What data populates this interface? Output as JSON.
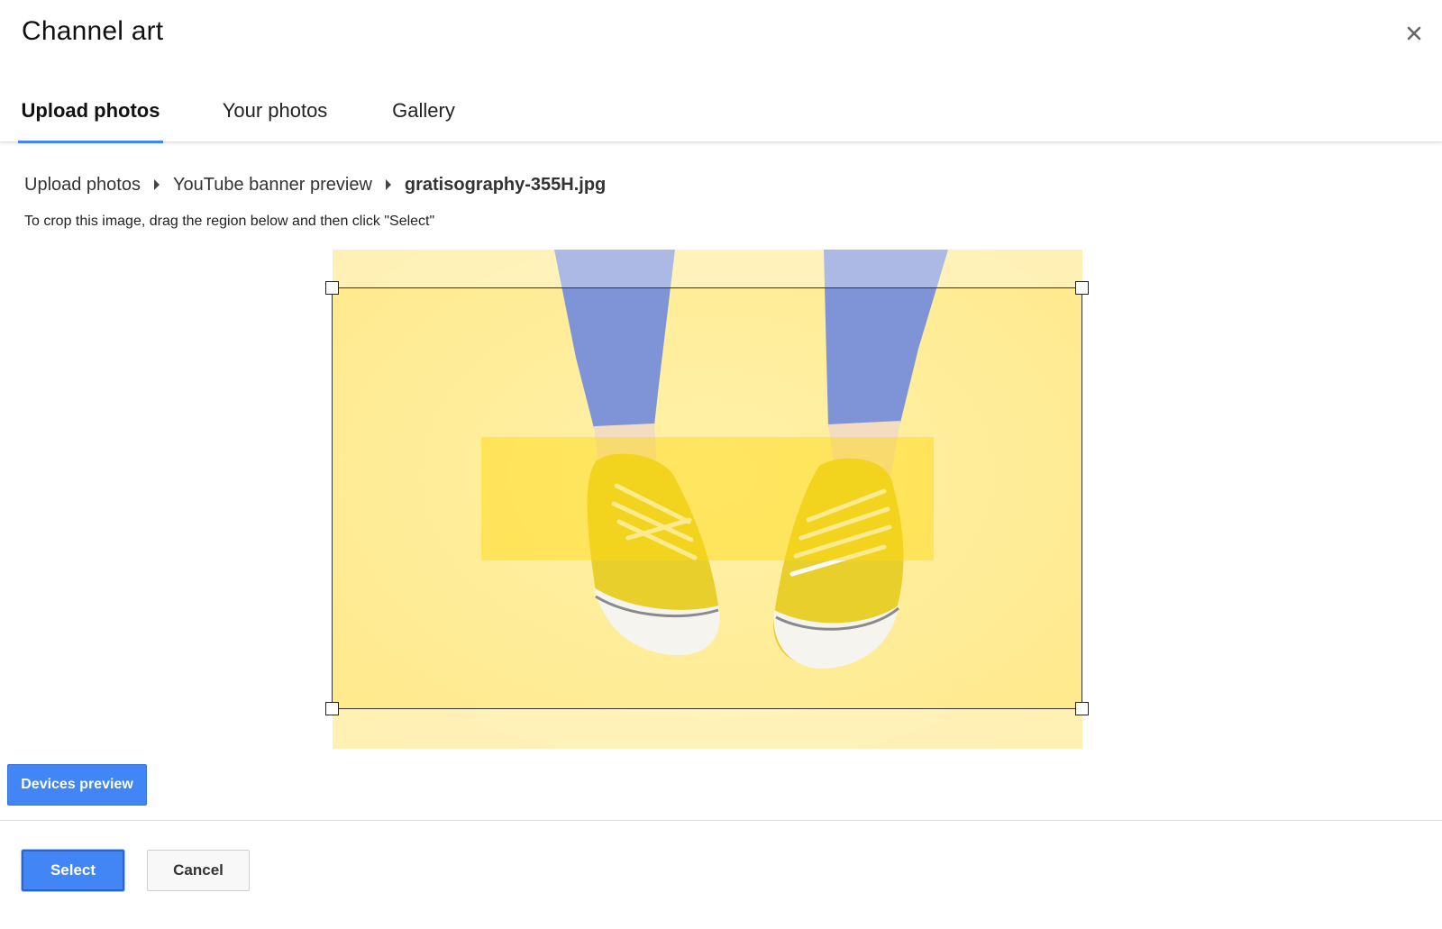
{
  "dialog": {
    "title": "Channel art",
    "close_icon": "close-icon"
  },
  "tabs": [
    {
      "label": "Upload photos",
      "active": true
    },
    {
      "label": "Your photos",
      "active": false
    },
    {
      "label": "Gallery",
      "active": false
    }
  ],
  "breadcrumb": {
    "items": [
      "Upload photos",
      "YouTube banner preview",
      "gratisography-355H.jpg"
    ],
    "separator_icon": "caret-right-icon"
  },
  "instructions": "To crop this image, drag the region below and then click \"Select\"",
  "buttons": {
    "devices_preview": "Devices preview",
    "select": "Select",
    "cancel": "Cancel"
  },
  "colors": {
    "accent": "#4285f4",
    "image_background": "#ffe98f"
  }
}
